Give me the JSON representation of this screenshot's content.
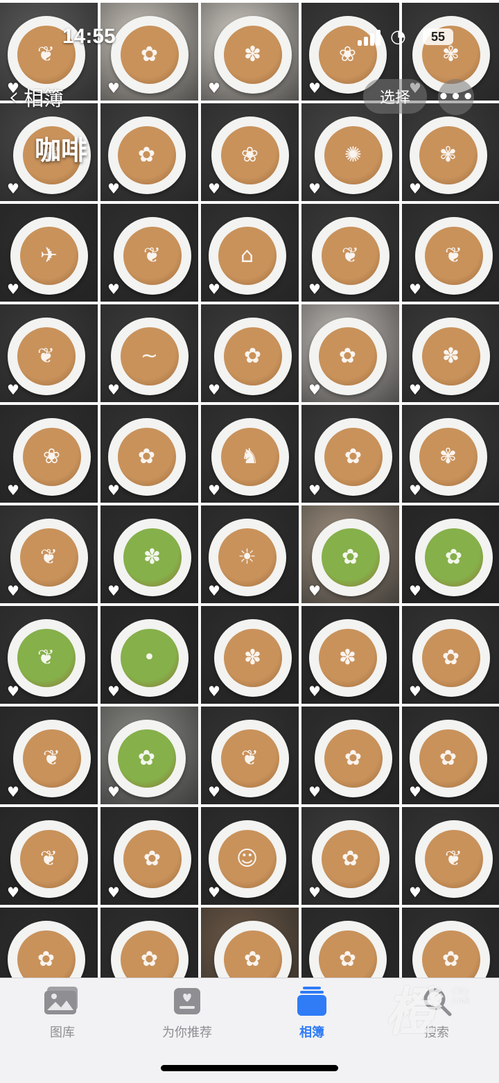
{
  "status_bar": {
    "time": "14:55",
    "battery": "55"
  },
  "nav": {
    "back_label": "相簿",
    "select_label": "选择",
    "more_label": "•••"
  },
  "album": {
    "title": "咖啡"
  },
  "grid": {
    "columns": 5,
    "rows": 10,
    "tiles": [
      {
        "bg": "#5a5a5a",
        "kind": "coffee",
        "art": "❦"
      },
      {
        "bg": "#c9c4bb",
        "kind": "coffee",
        "art": "✿"
      },
      {
        "bg": "#cfcac2",
        "kind": "coffee",
        "art": "✽"
      },
      {
        "bg": "#3a3a3a",
        "kind": "coffee",
        "art": "❀"
      },
      {
        "bg": "#3c3c3c",
        "kind": "coffee",
        "art": "✾"
      },
      {
        "bg": "#474747",
        "kind": "coffee",
        "art": "❦"
      },
      {
        "bg": "#3f3f3f",
        "kind": "coffee",
        "art": "✿"
      },
      {
        "bg": "#3b3b3b",
        "kind": "coffee",
        "art": "❀"
      },
      {
        "bg": "#444444",
        "kind": "coffee",
        "art": "✺"
      },
      {
        "bg": "#3d3d3d",
        "kind": "coffee",
        "art": "✾"
      },
      {
        "bg": "#2e2e2e",
        "kind": "coffee",
        "art": "✈"
      },
      {
        "bg": "#303030",
        "kind": "coffee",
        "art": "❦"
      },
      {
        "bg": "#333333",
        "kind": "coffee",
        "art": "⌂"
      },
      {
        "bg": "#3a3a3a",
        "kind": "coffee",
        "art": "❦"
      },
      {
        "bg": "#333333",
        "kind": "coffee",
        "art": "❦"
      },
      {
        "bg": "#3a3a3a",
        "kind": "coffee",
        "art": "❦"
      },
      {
        "bg": "#3a3a3a",
        "kind": "coffee",
        "art": "~"
      },
      {
        "bg": "#3a3a3a",
        "kind": "coffee",
        "art": "✿"
      },
      {
        "bg": "#bfbab5",
        "kind": "coffee",
        "art": "✿"
      },
      {
        "bg": "#3a3a3a",
        "kind": "coffee",
        "art": "✽"
      },
      {
        "bg": "#2f2f2f",
        "kind": "coffee",
        "art": "❀"
      },
      {
        "bg": "#333333",
        "kind": "coffee",
        "art": "✿"
      },
      {
        "bg": "#333333",
        "kind": "coffee",
        "art": "♞"
      },
      {
        "bg": "#3a3a3a",
        "kind": "coffee",
        "art": "✿"
      },
      {
        "bg": "#3a3a3a",
        "kind": "coffee",
        "art": "✾"
      },
      {
        "bg": "#383838",
        "kind": "coffee",
        "art": "❦"
      },
      {
        "bg": "#2e2e2e",
        "kind": "matcha",
        "art": "✽"
      },
      {
        "bg": "#303030",
        "kind": "coffee",
        "art": "☀"
      },
      {
        "bg": "#9d8f7e",
        "kind": "matcha",
        "art": "✿"
      },
      {
        "bg": "#2a2a2a",
        "kind": "matcha",
        "art": "✿"
      },
      {
        "bg": "#333333",
        "kind": "matcha",
        "art": "❦"
      },
      {
        "bg": "#2a2a2a",
        "kind": "matcha",
        "art": "•"
      },
      {
        "bg": "#2d2d2d",
        "kind": "coffee",
        "art": "✽"
      },
      {
        "bg": "#2d2d2d",
        "kind": "coffee",
        "art": "✽"
      },
      {
        "bg": "#333333",
        "kind": "coffee",
        "art": "✿"
      },
      {
        "bg": "#2e2e2e",
        "kind": "coffee",
        "art": "❦"
      },
      {
        "bg": "#8a8a86",
        "kind": "matcha",
        "art": "✿"
      },
      {
        "bg": "#333333",
        "kind": "coffee",
        "art": "❦"
      },
      {
        "bg": "#2f2f2f",
        "kind": "coffee",
        "art": "✿"
      },
      {
        "bg": "#303030",
        "kind": "coffee",
        "art": "✿"
      },
      {
        "bg": "#2c2c2c",
        "kind": "coffee",
        "art": "❦"
      },
      {
        "bg": "#2e2e2e",
        "kind": "coffee",
        "art": "✿"
      },
      {
        "bg": "#2e2e2e",
        "kind": "coffee",
        "art": "☺"
      },
      {
        "bg": "#3a3a3a",
        "kind": "coffee",
        "art": "✿"
      },
      {
        "bg": "#333333",
        "kind": "coffee",
        "art": "❦"
      },
      {
        "bg": "#2c2c2c",
        "kind": "coffee",
        "art": "✿"
      },
      {
        "bg": "#2e2e2e",
        "kind": "coffee",
        "art": "✿"
      },
      {
        "bg": "#6b5846",
        "kind": "coffee",
        "art": "✿"
      },
      {
        "bg": "#2e2e2e",
        "kind": "coffee",
        "art": "✿"
      },
      {
        "bg": "#303030",
        "kind": "coffee",
        "art": "✿"
      }
    ]
  },
  "tabs": [
    {
      "label": "图库",
      "icon": "photos-library-icon",
      "active": false
    },
    {
      "label": "为你推荐",
      "icon": "for-you-icon",
      "active": false
    },
    {
      "label": "相簿",
      "icon": "albums-icon",
      "active": true
    },
    {
      "label": "搜索",
      "icon": "search-icon",
      "active": false
    }
  ],
  "colors": {
    "accent": "#2f7cf6",
    "inactive": "#8e8e93",
    "coffee": "#c9925b",
    "matcha": "#86b04a"
  }
}
